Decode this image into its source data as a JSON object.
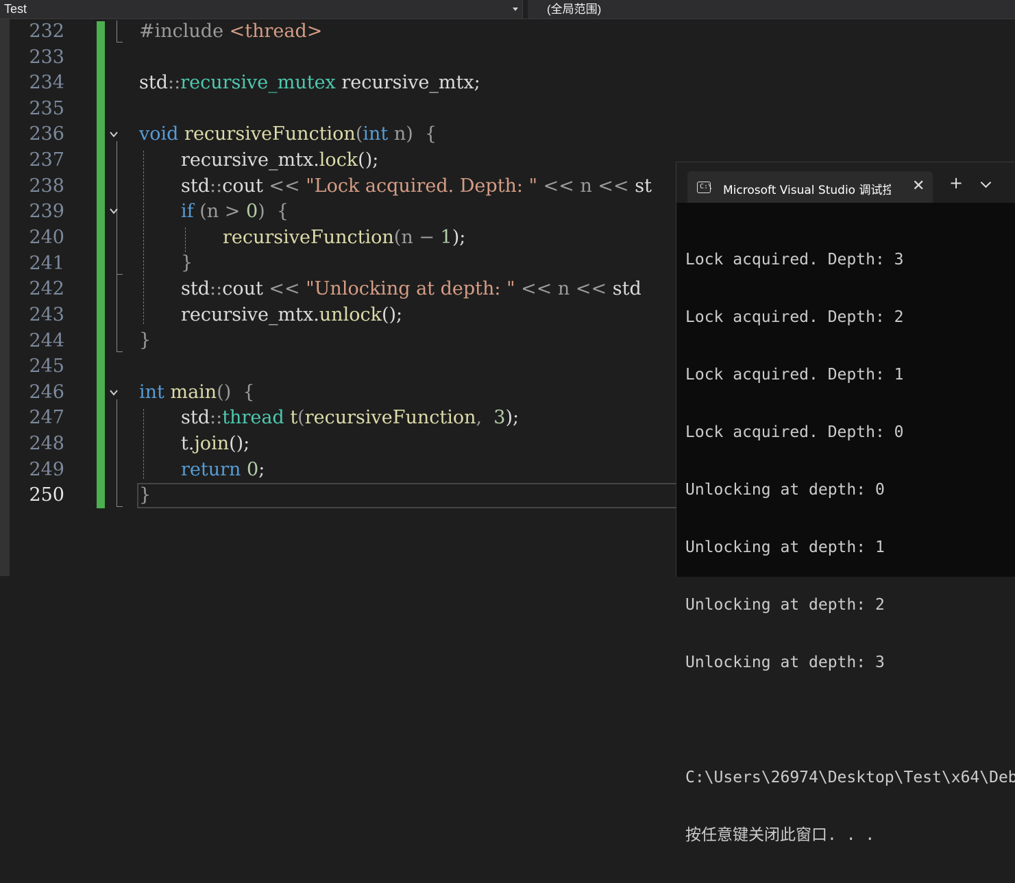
{
  "nav": {
    "project": "Test",
    "scope": "(全局范围)"
  },
  "editor": {
    "line_numbers": [
      "232",
      "233",
      "234",
      "235",
      "236",
      "237",
      "238",
      "239",
      "240",
      "241",
      "242",
      "243",
      "244",
      "245",
      "246",
      "247",
      "248",
      "249",
      "250"
    ],
    "current_line": "250",
    "code": {
      "l232": {
        "a": "#include ",
        "b": "<thread>"
      },
      "l234": {
        "a": "std",
        "b": "::",
        "c": "recursive_mutex",
        "d": " recursive_mtx;"
      },
      "l236": {
        "a": "void",
        "b": " ",
        "c": "recursiveFunction",
        "d": "(",
        "e": "int",
        "f": " n",
        "g": ")  {"
      },
      "l237": {
        "a": "recursive_mtx.",
        "b": "lock",
        "c": "();"
      },
      "l238": {
        "a": "std",
        "b": "::",
        "c": "cout ",
        "d": "<< ",
        "e": "\"Lock acquired. Depth: \"",
        "f": " << ",
        "g": "n",
        "h": " << ",
        "i": "st"
      },
      "l239": {
        "a": "if",
        "b": " (n ",
        "c": ">",
        "d": " ",
        "e": "0",
        "f": ")  {"
      },
      "l240": {
        "a": "recursiveFunction",
        "b": "(n ",
        "c": "−",
        "d": " ",
        "e": "1",
        "f": ");"
      },
      "l241": {
        "a": "}"
      },
      "l242": {
        "a": "std",
        "b": "::",
        "c": "cout ",
        "d": "<< ",
        "e": "\"Unlocking at depth: \"",
        "f": " << ",
        "g": "n",
        "h": " << ",
        "i": "std"
      },
      "l243": {
        "a": "recursive_mtx.",
        "b": "unlock",
        "c": "();"
      },
      "l244": {
        "a": "}"
      },
      "l246": {
        "a": "int",
        "b": " ",
        "c": "main",
        "d": "()  {"
      },
      "l247": {
        "a": "std",
        "b": "::",
        "c": "thread",
        "d": " ",
        "e": "t",
        "f": "(",
        "g": "recursiveFunction",
        "h": ",  ",
        "i": "3",
        "j": ");"
      },
      "l248": {
        "a": "t.",
        "b": "join",
        "c": "();"
      },
      "l249": {
        "a": "return",
        "b": " ",
        "c": "0",
        "d": ";"
      },
      "l250": {
        "a": "}"
      }
    }
  },
  "console": {
    "tab_title": "Microsoft Visual Studio 调试控制台",
    "close_glyph": "✕",
    "new_tab_glyph": "+",
    "icon_glyph": "C:\\",
    "lines": [
      "Lock acquired. Depth: 3",
      "Lock acquired. Depth: 2",
      "Lock acquired. Depth: 1",
      "Lock acquired. Depth: 0",
      "Unlocking at depth: 0",
      "Unlocking at depth: 1",
      "Unlocking at depth: 2",
      "Unlocking at depth: 3",
      "",
      "C:\\Users\\26974\\Desktop\\Test\\x64\\Deb",
      "按任意键关闭此窗口. . ."
    ]
  }
}
